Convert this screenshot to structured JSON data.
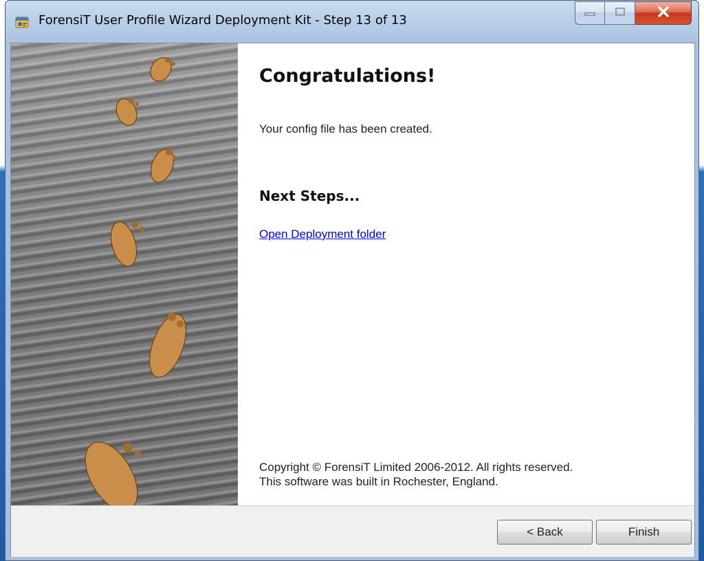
{
  "window": {
    "title": "ForensiT User Profile Wizard Deployment Kit - Step 13 of 13",
    "caption_minimize": "minimize-icon",
    "caption_maximize": "maximize-icon",
    "caption_close": "close-icon"
  },
  "content": {
    "heading": "Congratulations!",
    "message": "Your config file has been created.",
    "next_steps_heading": "Next Steps...",
    "open_folder_link": "Open Deployment folder",
    "copyright_line1": "Copyright © ForensiT Limited 2006-2012. All rights reserved.",
    "copyright_line2": "This software was built in Rochester, England."
  },
  "footer": {
    "back_label": "< Back",
    "finish_label": "Finish"
  },
  "icons": {
    "app": "app-icon",
    "side_image": "footprints-in-sand-image"
  },
  "colors": {
    "link": "#0000ee",
    "close_button": "#c8381a",
    "titlebar": "#b9cfe8"
  }
}
